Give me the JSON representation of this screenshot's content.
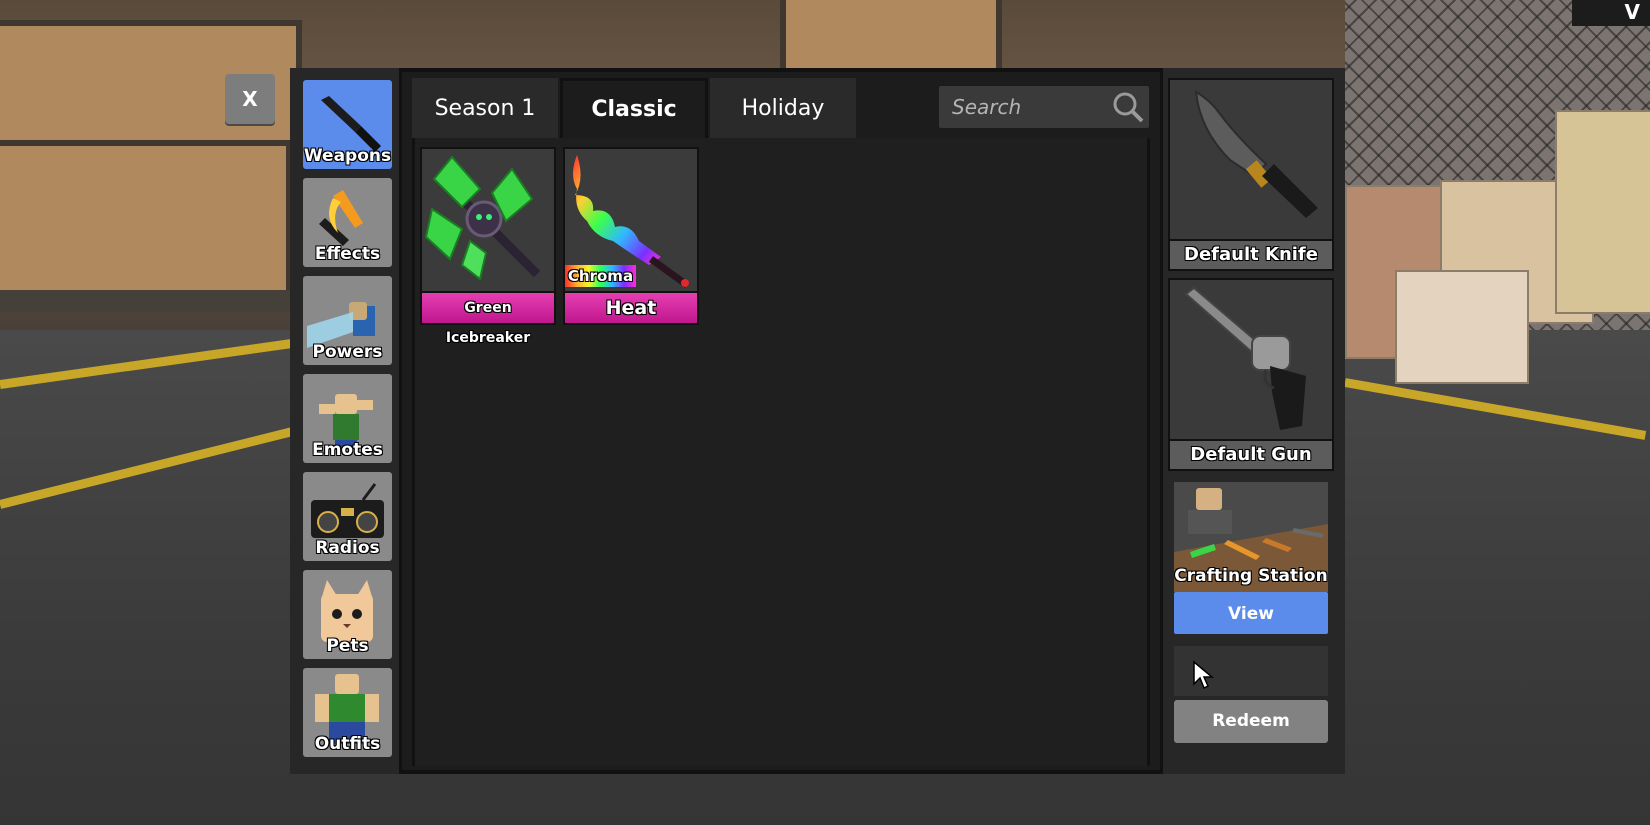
{
  "window": {
    "corner_badge": "V"
  },
  "close_button": {
    "label": "X"
  },
  "categories": [
    {
      "label": "Weapons",
      "icon": "knife-icon",
      "active": true
    },
    {
      "label": "Effects",
      "icon": "flame-knife-icon",
      "active": false
    },
    {
      "label": "Powers",
      "icon": "power-icon",
      "active": false
    },
    {
      "label": "Emotes",
      "icon": "emote-icon",
      "active": false
    },
    {
      "label": "Radios",
      "icon": "boombox-icon",
      "active": false
    },
    {
      "label": "Pets",
      "icon": "pet-icon",
      "active": false
    },
    {
      "label": "Outfits",
      "icon": "outfit-icon",
      "active": false
    }
  ],
  "tabs": [
    {
      "label": "Season 1",
      "active": false
    },
    {
      "label": "Classic",
      "active": true
    },
    {
      "label": "Holiday",
      "active": false
    }
  ],
  "search": {
    "placeholder": "Search",
    "value": ""
  },
  "items": [
    {
      "name": "Green Icebreaker",
      "tag": "",
      "icon": "green-icebreaker-icon"
    },
    {
      "name": "Heat",
      "tag": "Chroma",
      "icon": "chroma-heat-icon"
    }
  ],
  "equipped": {
    "knife": {
      "label": "Default Knife",
      "icon": "default-knife-icon"
    },
    "gun": {
      "label": "Default Gun",
      "icon": "revolver-icon"
    }
  },
  "crafting": {
    "title": "Crafting Station",
    "button": "View"
  },
  "redeem": {
    "code_placeholder": "",
    "button": "Redeem"
  },
  "colors": {
    "accent_blue": "#5b8cec",
    "item_pink": "#d62aa0",
    "panel_dark": "#1c1c1c"
  }
}
